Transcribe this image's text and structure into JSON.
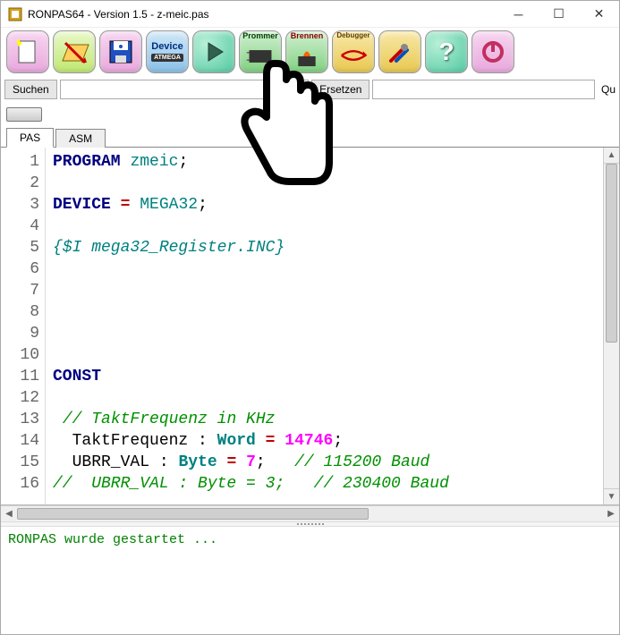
{
  "window": {
    "title": "RONPAS64 - Version 1.5 - z-meic.pas"
  },
  "toolbar": {
    "items": [
      {
        "name": "new",
        "label": ""
      },
      {
        "name": "open",
        "label": ""
      },
      {
        "name": "save",
        "label": ""
      },
      {
        "name": "device",
        "label": "Device",
        "sub": "ATMEGA"
      },
      {
        "name": "run",
        "label": ""
      },
      {
        "name": "prommer",
        "label": "Prommer"
      },
      {
        "name": "brennen",
        "label": "Brennen"
      },
      {
        "name": "debugger",
        "label": "Debugger"
      },
      {
        "name": "tools",
        "label": ""
      },
      {
        "name": "help",
        "label": "?"
      },
      {
        "name": "power",
        "label": ""
      }
    ]
  },
  "search": {
    "suchen": "Suchen",
    "ersetzen": "Ersetzen",
    "qu": "Qu",
    "field1": "",
    "field2": ""
  },
  "tabs": {
    "pas": "PAS",
    "asm": "ASM",
    "active": "pas"
  },
  "code": {
    "lines": [
      {
        "n": 1,
        "t": [
          [
            "kw",
            "PROGRAM"
          ],
          [
            "",
            " "
          ],
          [
            "ident",
            "zmeic"
          ],
          [
            "",
            ";"
          ]
        ]
      },
      {
        "n": 2,
        "t": []
      },
      {
        "n": 3,
        "t": [
          [
            "kw",
            "DEVICE"
          ],
          [
            "",
            " "
          ],
          [
            "eq",
            "="
          ],
          [
            "",
            " "
          ],
          [
            "ident",
            "MEGA32"
          ],
          [
            "",
            ";"
          ]
        ]
      },
      {
        "n": 4,
        "t": []
      },
      {
        "n": 5,
        "t": [
          [
            "dir",
            "{$I mega32_Register.INC}"
          ]
        ]
      },
      {
        "n": 6,
        "t": []
      },
      {
        "n": 7,
        "t": []
      },
      {
        "n": 8,
        "t": []
      },
      {
        "n": 9,
        "t": []
      },
      {
        "n": 10,
        "t": []
      },
      {
        "n": 11,
        "t": [
          [
            "kw",
            "CONST"
          ]
        ]
      },
      {
        "n": 12,
        "t": []
      },
      {
        "n": 13,
        "t": [
          [
            "",
            " "
          ],
          [
            "cmt",
            "// TaktFrequenz in KHz"
          ]
        ]
      },
      {
        "n": 14,
        "t": [
          [
            "",
            "  TaktFrequenz : "
          ],
          [
            "type",
            "Word"
          ],
          [
            "",
            " "
          ],
          [
            "eq",
            "="
          ],
          [
            "",
            " "
          ],
          [
            "num",
            "14746"
          ],
          [
            "",
            ";"
          ]
        ]
      },
      {
        "n": 15,
        "t": [
          [
            "",
            "  UBRR_VAL : "
          ],
          [
            "type",
            "Byte"
          ],
          [
            "",
            " "
          ],
          [
            "eq",
            "="
          ],
          [
            "",
            " "
          ],
          [
            "num",
            "7"
          ],
          [
            "",
            ";   "
          ],
          [
            "cmt",
            "// 115200 Baud"
          ]
        ]
      },
      {
        "n": 16,
        "t": [
          [
            "cmt",
            "//  UBRR_VAL : Byte = 3;   // 230400 Baud"
          ]
        ]
      }
    ]
  },
  "console": {
    "text": "RONPAS wurde gestartet ..."
  }
}
